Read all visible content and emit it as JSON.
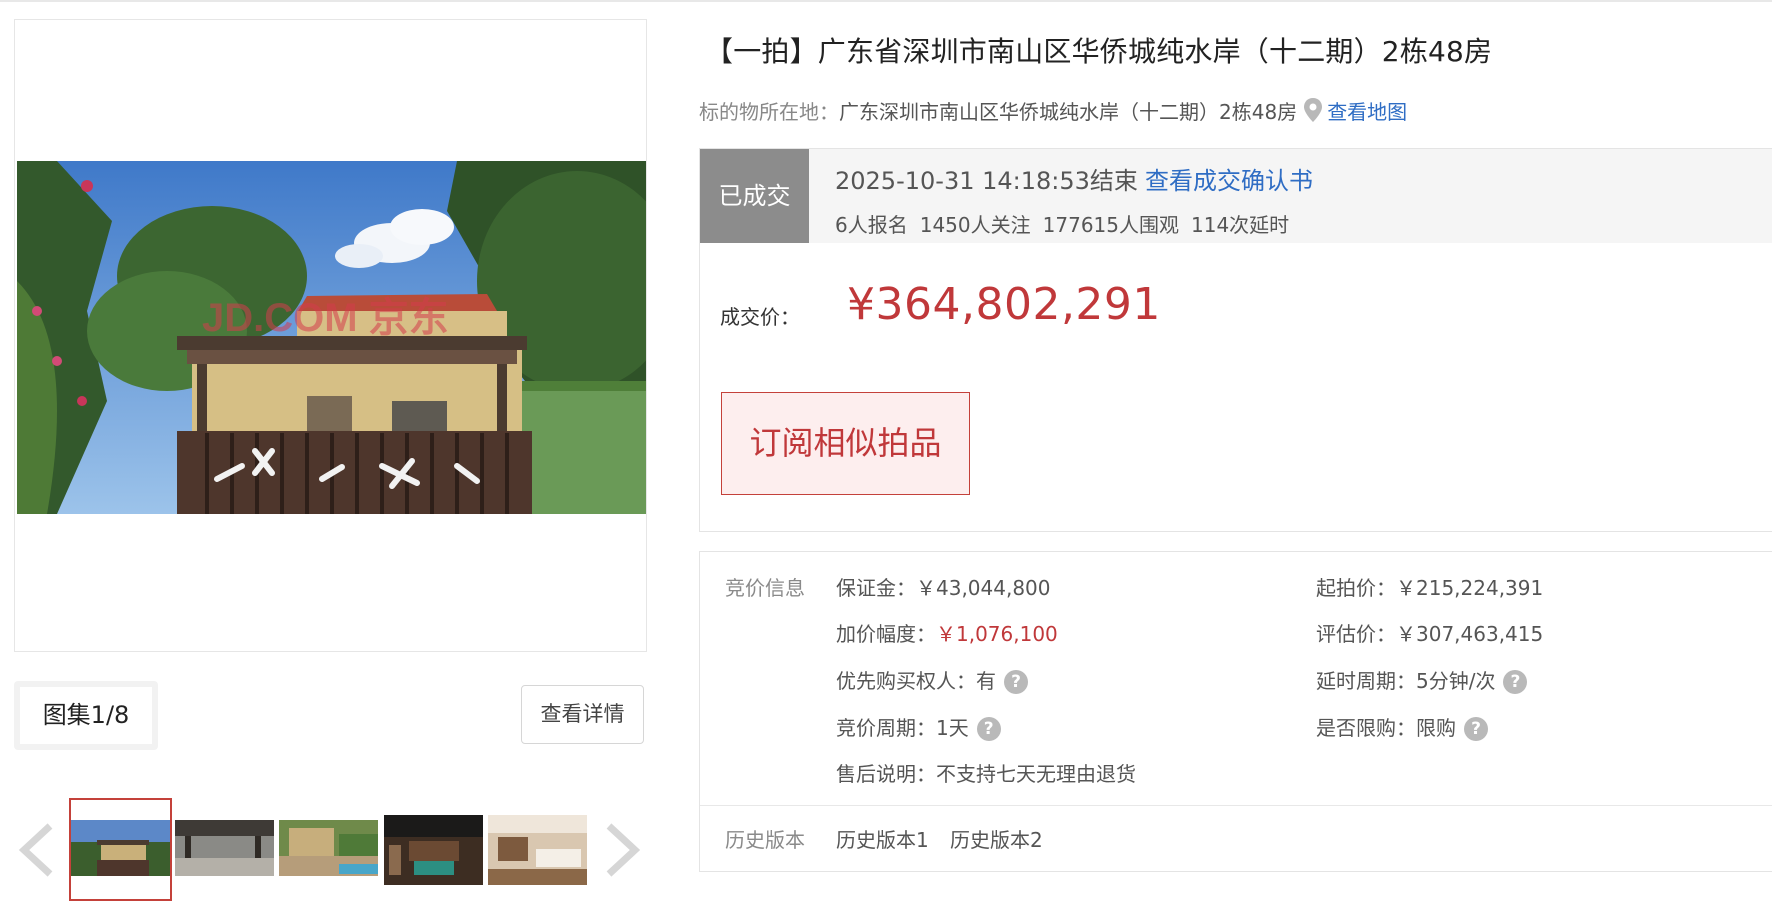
{
  "gallery": {
    "counter": "图集1/8",
    "details_button": "查看详情",
    "thumbnail_count": 5,
    "selected_thumbnail": 1,
    "watermark": "JD.COM 京东"
  },
  "listing": {
    "title": "【一拍】广东省深圳市南山区华侨城纯水岸（十二期）2栋48房",
    "location_label": "标的物所在地：",
    "location_value": "广东深圳市南山区华侨城纯水岸（十二期）2栋48房",
    "map_link": "查看地图"
  },
  "status": {
    "badge": "已成交",
    "end_time": "2025-10-31 14:18:53结束",
    "certificate_link": "查看成交确认书",
    "stats": [
      "6人报名",
      "1450人关注",
      "177615人围观",
      "114次延时"
    ]
  },
  "deal": {
    "label": "成交价：",
    "price": "¥364,802,291",
    "subscribe_button": "订阅相似拍品"
  },
  "bidding": {
    "section_label": "竞价信息",
    "deposit": {
      "label": "保证金：",
      "value": "￥43,044,800"
    },
    "start_price": {
      "label": "起拍价：",
      "value": "￥215,224,391"
    },
    "increment": {
      "label": "加价幅度：",
      "value": "￥1,076,100"
    },
    "appraisal": {
      "label": "评估价：",
      "value": "￥307,463,415"
    },
    "priority": {
      "label": "优先购买权人：",
      "value": "有"
    },
    "delay_cycle": {
      "label": "延时周期：",
      "value": "5分钟/次"
    },
    "bid_cycle": {
      "label": "竞价周期：",
      "value": "1天"
    },
    "purchase_limit": {
      "label": "是否限购：",
      "value": "限购"
    },
    "after_sale": {
      "label": "售后说明：",
      "value": "不支持七天无理由退货"
    },
    "help_glyph": "?"
  },
  "history": {
    "section_label": "历史版本",
    "versions": [
      "历史版本1",
      "历史版本2"
    ]
  },
  "colors": {
    "accent_red": "#c0383a",
    "link_blue": "#2f6dc4",
    "status_gray": "#8c8c8c"
  }
}
